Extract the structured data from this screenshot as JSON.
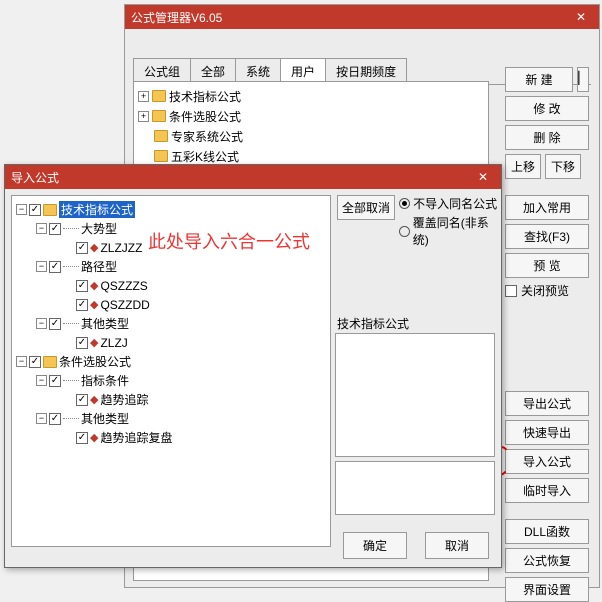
{
  "main": {
    "title": "公式管理器V6.05",
    "tabs": [
      "公式组",
      "全部",
      "系统",
      "用户",
      "按日期频度"
    ],
    "active_tab": 3,
    "tree": [
      "技术指标公式",
      "条件选股公式",
      "专家系统公式",
      "五彩K线公式"
    ],
    "buttons": {
      "new": "新 建",
      "modify": "修 改",
      "delete": "删 除",
      "up": "上移",
      "down": "下移",
      "add_common": "加入常用",
      "find": "查找(F3)",
      "preview": "预 览",
      "close_preview": "关闭预览",
      "export": "导出公式",
      "quick_export": "快速导出",
      "import": "导入公式",
      "temp_import": "临时导入",
      "dll": "DLL函数",
      "restore": "公式恢复",
      "ui_setting": "界面设置"
    }
  },
  "dlg": {
    "title": "导入公式",
    "cancel_all": "全部取消",
    "radio1": "不导入同名公式",
    "radio2": "覆盖同名(非系统)",
    "preview_label": "技术指标公式",
    "ok": "确定",
    "cancel": "取消",
    "tree": {
      "n0": "技术指标公式",
      "n1": "大势型",
      "n2": "ZLZJZZ",
      "n3": "路径型",
      "n4": "QSZZZS",
      "n5": "QSZZDD",
      "n6": "其他类型",
      "n7": "ZLZJ",
      "n8": "条件选股公式",
      "n9": "指标条件",
      "n10": "趋势追踪",
      "n11": "其他类型",
      "n12": "趋势追踪复盘"
    }
  },
  "annotation": "此处导入六合一公式"
}
